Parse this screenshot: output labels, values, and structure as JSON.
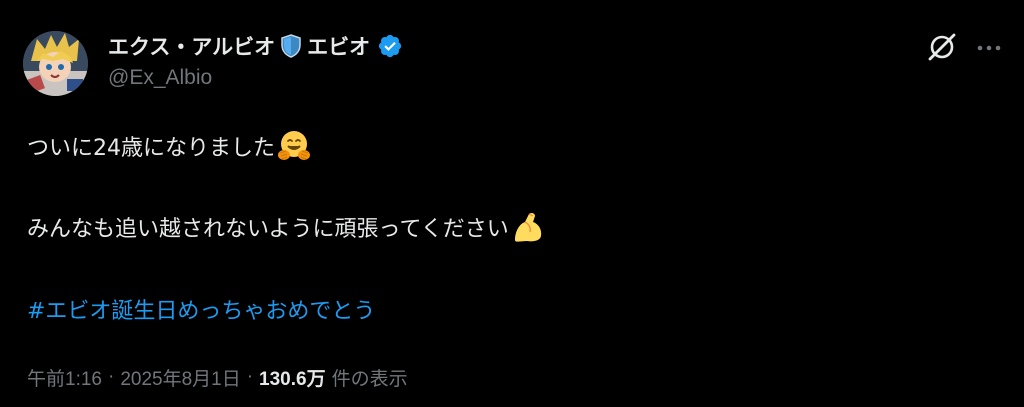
{
  "author": {
    "display_name_prefix": "エクス・アルビオ",
    "display_name_suffix": "エビオ",
    "handle": "@Ex_Albio",
    "name_emoji": "shield-emoji",
    "verified_icon": "verified-badge-icon",
    "verified_color": "#1d9bf0",
    "avatar": "avatar-image"
  },
  "actions": {
    "grok_icon": "grok-icon",
    "more_icon": "more-options-icon"
  },
  "body": {
    "line1_text": "ついに24歳になりました",
    "line1_emoji": "hugging-face-emoji",
    "line2_text": "みんなも追い越されないように頑張ってください",
    "line2_emoji": "flexed-biceps-emoji",
    "hashtag": "#エビオ誕生日めっちゃおめでとう",
    "hashtag_color": "#1d9bf0"
  },
  "meta": {
    "time": "午前1:16",
    "separator1": "·",
    "date": "2025年8月1日",
    "separator2": "·",
    "views_count": "130.6万",
    "views_label": "件の表示"
  },
  "colors": {
    "background": "#000000",
    "text": "#e7e9ea",
    "secondary": "#71767b",
    "accent": "#1d9bf0"
  }
}
